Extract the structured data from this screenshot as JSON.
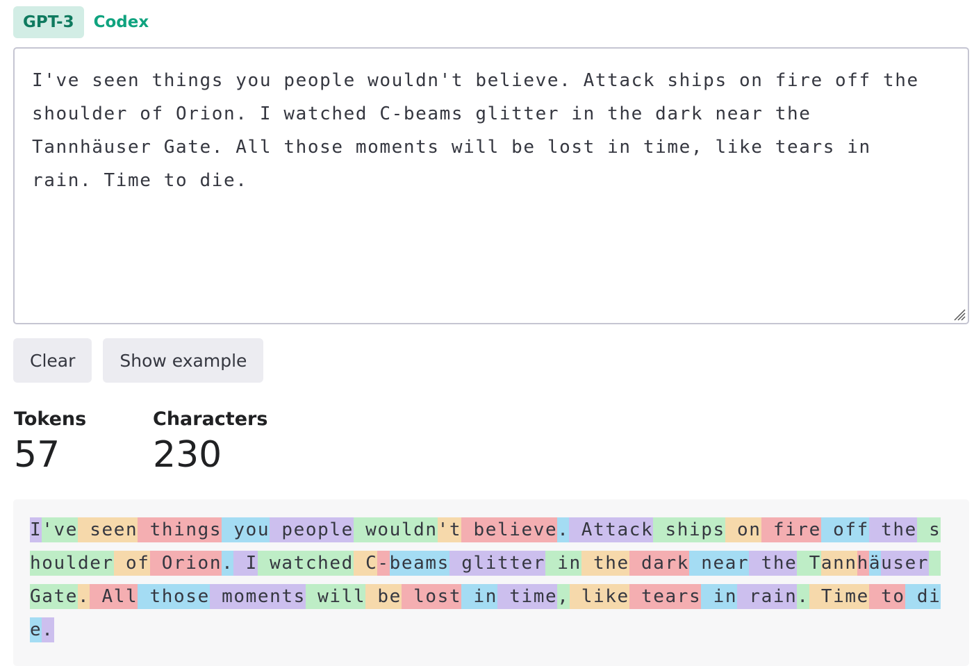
{
  "tabs": [
    {
      "label": "GPT-3",
      "active": true
    },
    {
      "label": "Codex",
      "active": false
    }
  ],
  "input": {
    "value": "I've seen things you people wouldn't believe. Attack ships on fire off the shoulder of Orion. I watched C-beams glitter in the dark near the Tannhäuser Gate. All those moments will be lost in time, like tears in rain. Time to die."
  },
  "buttons": {
    "clear_label": "Clear",
    "example_label": "Show example"
  },
  "stats": {
    "tokens_label": "Tokens",
    "tokens_value": "57",
    "characters_label": "Characters",
    "characters_value": "230"
  },
  "colors": {
    "accent": "#10a37f",
    "tab_active_bg": "#d2ede5",
    "button_bg": "#ececf1",
    "token_panel_bg": "#f7f7f8",
    "token_palette": [
      "#c8b4f0",
      "#b4edbc",
      "#f9dca8",
      "#f7b0b2",
      "#a6e0f6"
    ]
  },
  "tokens": [
    "I",
    "'ve",
    " seen",
    " things",
    " you",
    " people",
    " wouldn",
    "'t",
    " believe",
    ".",
    " Attack",
    " ships",
    " on",
    " fire",
    " off",
    " the",
    " shoulder",
    " of",
    " Orion",
    ".",
    " I",
    " watched",
    " C",
    "-",
    "beams",
    " glitter",
    " in",
    " the",
    " dark",
    " near",
    " the",
    " T",
    "ann",
    "h",
    "ä",
    "user",
    " Gate",
    ".",
    " All",
    " those",
    " moments",
    " will",
    " be",
    " lost",
    " in",
    " time",
    ",",
    " like",
    " tears",
    " in",
    " rain",
    ".",
    " Time",
    " to",
    " die",
    "."
  ]
}
